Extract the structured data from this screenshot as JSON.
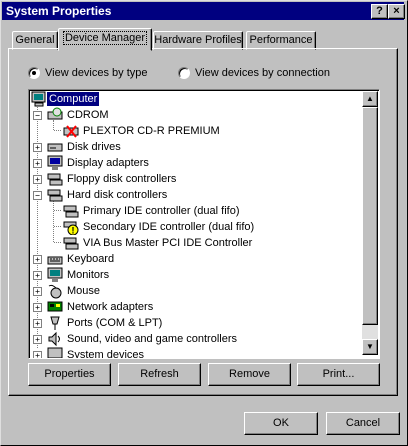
{
  "window": {
    "title": "System Properties"
  },
  "titlebar": {
    "help_glyph": "?",
    "close_glyph": "×"
  },
  "tabs": [
    {
      "label": "General",
      "active": false
    },
    {
      "label": "Device Manager",
      "active": true
    },
    {
      "label": "Hardware Profiles",
      "active": false
    },
    {
      "label": "Performance",
      "active": false
    }
  ],
  "view": {
    "by_type_label": "View devices by type",
    "by_connection_label": "View devices by connection",
    "selected": "by_type"
  },
  "tree": [
    {
      "label": "Computer",
      "icon": "computer-icon",
      "selected": true
    },
    {
      "label": "CDROM",
      "icon": "cdrom-icon",
      "expander": "−"
    },
    {
      "label": "PLEXTOR CD-R   PREMIUM",
      "icon": "cdrom-disabled-icon"
    },
    {
      "label": "Disk drives",
      "icon": "disk-drive-icon",
      "expander": "+"
    },
    {
      "label": "Display adapters",
      "icon": "display-adapter-icon",
      "expander": "+"
    },
    {
      "label": "Floppy disk controllers",
      "icon": "floppy-controller-icon",
      "expander": "+"
    },
    {
      "label": "Hard disk controllers",
      "icon": "hdd-controller-icon",
      "expander": "−"
    },
    {
      "label": "Primary IDE controller (dual fifo)",
      "icon": "ide-controller-icon"
    },
    {
      "label": "Secondary IDE controller (dual fifo)",
      "icon": "ide-controller-warning-icon"
    },
    {
      "label": "VIA Bus Master PCI IDE Controller",
      "icon": "ide-controller-icon"
    },
    {
      "label": "Keyboard",
      "icon": "keyboard-icon",
      "expander": "+"
    },
    {
      "label": "Monitors",
      "icon": "monitor-icon",
      "expander": "+"
    },
    {
      "label": "Mouse",
      "icon": "mouse-icon",
      "expander": "+"
    },
    {
      "label": "Network adapters",
      "icon": "network-adapter-icon",
      "expander": "+"
    },
    {
      "label": "Ports (COM & LPT)",
      "icon": "port-icon",
      "expander": "+"
    },
    {
      "label": "Sound, video and game controllers",
      "icon": "sound-icon",
      "expander": "+"
    },
    {
      "label": "System devices",
      "icon": "system-device-icon",
      "expander": "+"
    }
  ],
  "buttons": {
    "properties": "Properties",
    "refresh": "Refresh",
    "remove": "Remove",
    "print": "Print...",
    "ok": "OK",
    "cancel": "Cancel"
  },
  "scrollbar": {
    "up_glyph": "▲",
    "down_glyph": "▼"
  },
  "colors": {
    "title_bar": "#000080",
    "selection": "#000080",
    "face": "#c0c0c0"
  }
}
